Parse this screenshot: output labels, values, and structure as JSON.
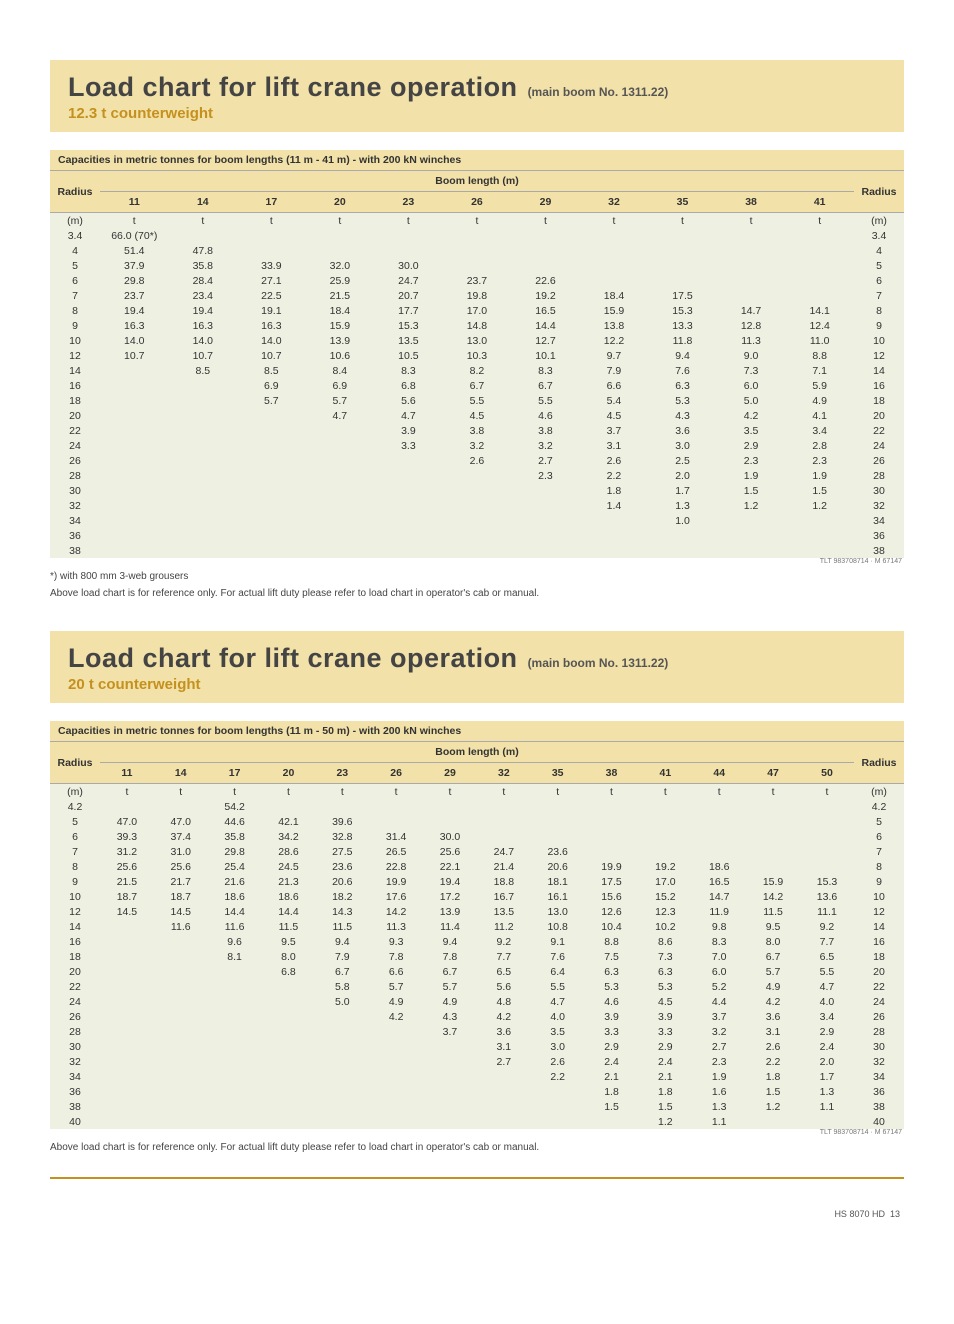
{
  "section1": {
    "title_main": "Load chart for lift crane operation",
    "title_sub": "(main boom No. 1311.22)",
    "counterweight": "12.3 t counterweight",
    "caption": "Capacities in metric tonnes for boom lengths (11 m - 41 m) - with 200 kN winches",
    "boom_header": "Boom length (m)",
    "radius_label": "Radius",
    "radius_unit": "(m)",
    "col_unit": "t",
    "ref_id": "TLT 983708714 · M 67147",
    "footnote1": "*) with 800 mm 3-web grousers",
    "footnote2": "Above load chart is for reference only. For actual lift duty please refer to load chart in operator's cab or manual."
  },
  "chart_data": [
    {
      "type": "table",
      "title": "Load chart 12.3 t counterweight",
      "x_label": "Boom length (m)",
      "y_label": "Radius (m)",
      "columns": [
        "11",
        "14",
        "17",
        "20",
        "23",
        "26",
        "29",
        "32",
        "35",
        "38",
        "41"
      ],
      "rows": [
        {
          "r": "3.4",
          "v": [
            "66.0 (70*)",
            "",
            "",
            "",
            "",
            "",
            "",
            "",
            "",
            "",
            ""
          ]
        },
        {
          "r": "4",
          "v": [
            "51.4",
            "47.8",
            "",
            "",
            "",
            "",
            "",
            "",
            "",
            "",
            ""
          ]
        },
        {
          "r": "5",
          "v": [
            "37.9",
            "35.8",
            "33.9",
            "32.0",
            "30.0",
            "",
            "",
            "",
            "",
            "",
            ""
          ]
        },
        {
          "r": "6",
          "v": [
            "29.8",
            "28.4",
            "27.1",
            "25.9",
            "24.7",
            "23.7",
            "22.6",
            "",
            "",
            "",
            ""
          ]
        },
        {
          "r": "7",
          "v": [
            "23.7",
            "23.4",
            "22.5",
            "21.5",
            "20.7",
            "19.8",
            "19.2",
            "18.4",
            "17.5",
            "",
            ""
          ]
        },
        {
          "r": "8",
          "v": [
            "19.4",
            "19.4",
            "19.1",
            "18.4",
            "17.7",
            "17.0",
            "16.5",
            "15.9",
            "15.3",
            "14.7",
            "14.1"
          ]
        },
        {
          "r": "9",
          "v": [
            "16.3",
            "16.3",
            "16.3",
            "15.9",
            "15.3",
            "14.8",
            "14.4",
            "13.8",
            "13.3",
            "12.8",
            "12.4"
          ]
        },
        {
          "r": "10",
          "v": [
            "14.0",
            "14.0",
            "14.0",
            "13.9",
            "13.5",
            "13.0",
            "12.7",
            "12.2",
            "11.8",
            "11.3",
            "11.0"
          ]
        },
        {
          "r": "12",
          "v": [
            "10.7",
            "10.7",
            "10.7",
            "10.6",
            "10.5",
            "10.3",
            "10.1",
            "9.7",
            "9.4",
            "9.0",
            "8.8"
          ]
        },
        {
          "r": "14",
          "v": [
            "",
            "8.5",
            "8.5",
            "8.4",
            "8.3",
            "8.2",
            "8.3",
            "7.9",
            "7.6",
            "7.3",
            "7.1"
          ]
        },
        {
          "r": "16",
          "v": [
            "",
            "",
            "6.9",
            "6.9",
            "6.8",
            "6.7",
            "6.7",
            "6.6",
            "6.3",
            "6.0",
            "5.9"
          ]
        },
        {
          "r": "18",
          "v": [
            "",
            "",
            "5.7",
            "5.7",
            "5.6",
            "5.5",
            "5.5",
            "5.4",
            "5.3",
            "5.0",
            "4.9"
          ]
        },
        {
          "r": "20",
          "v": [
            "",
            "",
            "",
            "4.7",
            "4.7",
            "4.5",
            "4.6",
            "4.5",
            "4.3",
            "4.2",
            "4.1"
          ]
        },
        {
          "r": "22",
          "v": [
            "",
            "",
            "",
            "",
            "3.9",
            "3.8",
            "3.8",
            "3.7",
            "3.6",
            "3.5",
            "3.4"
          ]
        },
        {
          "r": "24",
          "v": [
            "",
            "",
            "",
            "",
            "3.3",
            "3.2",
            "3.2",
            "3.1",
            "3.0",
            "2.9",
            "2.8"
          ]
        },
        {
          "r": "26",
          "v": [
            "",
            "",
            "",
            "",
            "",
            "2.6",
            "2.7",
            "2.6",
            "2.5",
            "2.3",
            "2.3"
          ]
        },
        {
          "r": "28",
          "v": [
            "",
            "",
            "",
            "",
            "",
            "",
            "2.3",
            "2.2",
            "2.0",
            "1.9",
            "1.9"
          ]
        },
        {
          "r": "30",
          "v": [
            "",
            "",
            "",
            "",
            "",
            "",
            "",
            "1.8",
            "1.7",
            "1.5",
            "1.5"
          ]
        },
        {
          "r": "32",
          "v": [
            "",
            "",
            "",
            "",
            "",
            "",
            "",
            "1.4",
            "1.3",
            "1.2",
            "1.2"
          ]
        },
        {
          "r": "34",
          "v": [
            "",
            "",
            "",
            "",
            "",
            "",
            "",
            "",
            "1.0",
            "",
            ""
          ]
        },
        {
          "r": "36",
          "v": [
            "",
            "",
            "",
            "",
            "",
            "",
            "",
            "",
            "",
            "",
            ""
          ]
        },
        {
          "r": "38",
          "v": [
            "",
            "",
            "",
            "",
            "",
            "",
            "",
            "",
            "",
            "",
            ""
          ]
        }
      ]
    },
    {
      "type": "table",
      "title": "Load chart 20 t counterweight",
      "x_label": "Boom length (m)",
      "y_label": "Radius (m)",
      "columns": [
        "11",
        "14",
        "17",
        "20",
        "23",
        "26",
        "29",
        "32",
        "35",
        "38",
        "41",
        "44",
        "47",
        "50"
      ],
      "rows": [
        {
          "r": "4.2",
          "v": [
            "",
            "",
            "54.2",
            "",
            "",
            "",
            "",
            "",
            "",
            "",
            "",
            "",
            "",
            ""
          ]
        },
        {
          "r": "5",
          "v": [
            "47.0",
            "47.0",
            "44.6",
            "42.1",
            "39.6",
            "",
            "",
            "",
            "",
            "",
            "",
            "",
            "",
            ""
          ]
        },
        {
          "r": "6",
          "v": [
            "39.3",
            "37.4",
            "35.8",
            "34.2",
            "32.8",
            "31.4",
            "30.0",
            "",
            "",
            "",
            "",
            "",
            "",
            ""
          ]
        },
        {
          "r": "7",
          "v": [
            "31.2",
            "31.0",
            "29.8",
            "28.6",
            "27.5",
            "26.5",
            "25.6",
            "24.7",
            "23.6",
            "",
            "",
            "",
            "",
            ""
          ]
        },
        {
          "r": "8",
          "v": [
            "25.6",
            "25.6",
            "25.4",
            "24.5",
            "23.6",
            "22.8",
            "22.1",
            "21.4",
            "20.6",
            "19.9",
            "19.2",
            "18.6",
            "",
            ""
          ]
        },
        {
          "r": "9",
          "v": [
            "21.5",
            "21.7",
            "21.6",
            "21.3",
            "20.6",
            "19.9",
            "19.4",
            "18.8",
            "18.1",
            "17.5",
            "17.0",
            "16.5",
            "15.9",
            "15.3"
          ]
        },
        {
          "r": "10",
          "v": [
            "18.7",
            "18.7",
            "18.6",
            "18.6",
            "18.2",
            "17.6",
            "17.2",
            "16.7",
            "16.1",
            "15.6",
            "15.2",
            "14.7",
            "14.2",
            "13.6"
          ]
        },
        {
          "r": "12",
          "v": [
            "14.5",
            "14.5",
            "14.4",
            "14.4",
            "14.3",
            "14.2",
            "13.9",
            "13.5",
            "13.0",
            "12.6",
            "12.3",
            "11.9",
            "11.5",
            "11.1"
          ]
        },
        {
          "r": "14",
          "v": [
            "",
            "11.6",
            "11.6",
            "11.5",
            "11.5",
            "11.3",
            "11.4",
            "11.2",
            "10.8",
            "10.4",
            "10.2",
            "9.8",
            "9.5",
            "9.2"
          ]
        },
        {
          "r": "16",
          "v": [
            "",
            "",
            "9.6",
            "9.5",
            "9.4",
            "9.3",
            "9.4",
            "9.2",
            "9.1",
            "8.8",
            "8.6",
            "8.3",
            "8.0",
            "7.7"
          ]
        },
        {
          "r": "18",
          "v": [
            "",
            "",
            "8.1",
            "8.0",
            "7.9",
            "7.8",
            "7.8",
            "7.7",
            "7.6",
            "7.5",
            "7.3",
            "7.0",
            "6.7",
            "6.5"
          ]
        },
        {
          "r": "20",
          "v": [
            "",
            "",
            "",
            "6.8",
            "6.7",
            "6.6",
            "6.7",
            "6.5",
            "6.4",
            "6.3",
            "6.3",
            "6.0",
            "5.7",
            "5.5"
          ]
        },
        {
          "r": "22",
          "v": [
            "",
            "",
            "",
            "",
            "5.8",
            "5.7",
            "5.7",
            "5.6",
            "5.5",
            "5.3",
            "5.3",
            "5.2",
            "4.9",
            "4.7"
          ]
        },
        {
          "r": "24",
          "v": [
            "",
            "",
            "",
            "",
            "5.0",
            "4.9",
            "4.9",
            "4.8",
            "4.7",
            "4.6",
            "4.5",
            "4.4",
            "4.2",
            "4.0"
          ]
        },
        {
          "r": "26",
          "v": [
            "",
            "",
            "",
            "",
            "",
            "4.2",
            "4.3",
            "4.2",
            "4.0",
            "3.9",
            "3.9",
            "3.7",
            "3.6",
            "3.4"
          ]
        },
        {
          "r": "28",
          "v": [
            "",
            "",
            "",
            "",
            "",
            "",
            "3.7",
            "3.6",
            "3.5",
            "3.3",
            "3.3",
            "3.2",
            "3.1",
            "2.9"
          ]
        },
        {
          "r": "30",
          "v": [
            "",
            "",
            "",
            "",
            "",
            "",
            "",
            "3.1",
            "3.0",
            "2.9",
            "2.9",
            "2.7",
            "2.6",
            "2.4"
          ]
        },
        {
          "r": "32",
          "v": [
            "",
            "",
            "",
            "",
            "",
            "",
            "",
            "2.7",
            "2.6",
            "2.4",
            "2.4",
            "2.3",
            "2.2",
            "2.0"
          ]
        },
        {
          "r": "34",
          "v": [
            "",
            "",
            "",
            "",
            "",
            "",
            "",
            "",
            "2.2",
            "2.1",
            "2.1",
            "1.9",
            "1.8",
            "1.7"
          ]
        },
        {
          "r": "36",
          "v": [
            "",
            "",
            "",
            "",
            "",
            "",
            "",
            "",
            "",
            "1.8",
            "1.8",
            "1.6",
            "1.5",
            "1.3"
          ]
        },
        {
          "r": "38",
          "v": [
            "",
            "",
            "",
            "",
            "",
            "",
            "",
            "",
            "",
            "1.5",
            "1.5",
            "1.3",
            "1.2",
            "1.1"
          ]
        },
        {
          "r": "40",
          "v": [
            "",
            "",
            "",
            "",
            "",
            "",
            "",
            "",
            "",
            "",
            "1.2",
            "1.1",
            "",
            ""
          ]
        }
      ]
    }
  ],
  "section2": {
    "title_main": "Load chart for lift crane operation",
    "title_sub": "(main boom No. 1311.22)",
    "counterweight": "20 t counterweight",
    "caption": "Capacities in metric tonnes for boom lengths (11 m - 50 m) - with 200 kN winches",
    "boom_header": "Boom length (m)",
    "radius_label": "Radius",
    "radius_unit": "(m)",
    "col_unit": "t",
    "ref_id": "TLT 983708714 · M 67147",
    "footnote": "Above load chart is for reference only. For actual lift duty please refer to load chart in operator's cab or manual."
  },
  "footer": {
    "model": "HS 8070 HD",
    "page": "13"
  }
}
